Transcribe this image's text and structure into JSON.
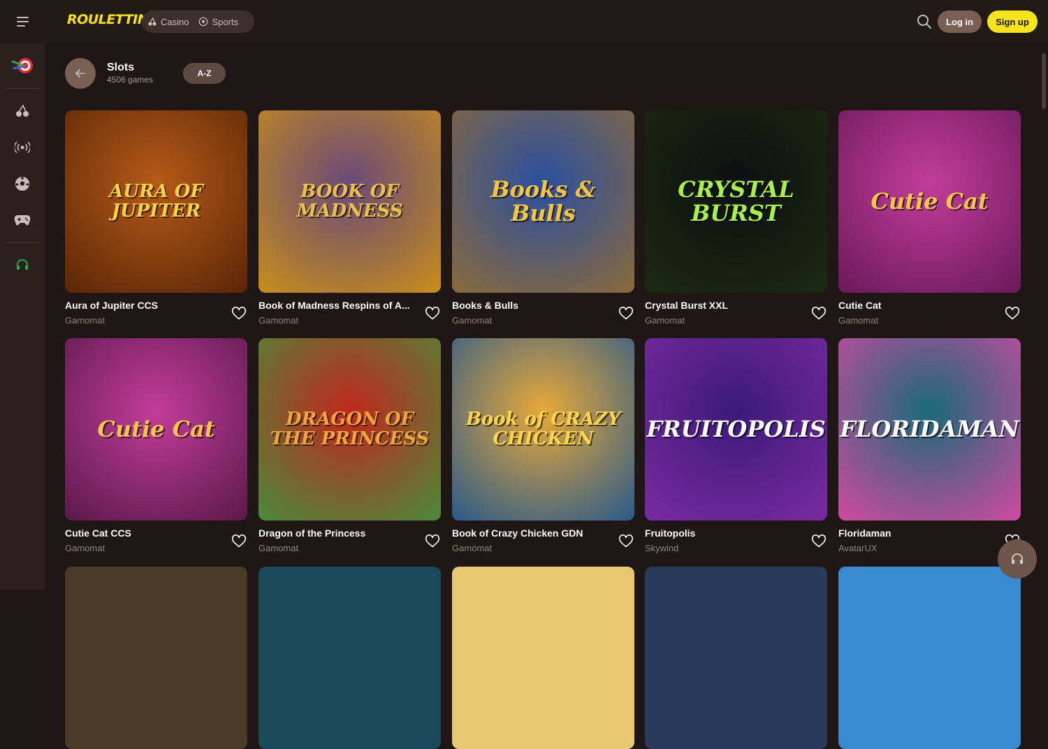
{
  "header": {
    "logo": "ROULETTINO",
    "nav": [
      {
        "label": "Casino",
        "icon": "cherry-icon"
      },
      {
        "label": "Sports",
        "icon": "soccer-ball-icon"
      }
    ],
    "login_label": "Log in",
    "signup_label": "Sign up"
  },
  "colors": {
    "accent": "#f5e31c",
    "button": "#7a5f55",
    "background": "#1e1715",
    "sidebar": "#2a211e"
  },
  "sidebar": {
    "items": [
      {
        "icon": "dart-target-icon"
      },
      {
        "icon": "cherry-icon"
      },
      {
        "icon": "live-broadcast-icon"
      },
      {
        "icon": "soccer-ball-icon"
      },
      {
        "icon": "gamepad-icon"
      },
      {
        "icon": "headset-icon"
      }
    ]
  },
  "page": {
    "title": "Slots",
    "count": "4506 games",
    "sort_label": "A-Z"
  },
  "games": [
    {
      "name": "Aura of Jupiter CCS",
      "provider": "Gamomat",
      "art": "AURA OF JUPITER",
      "bg": "#b65a18",
      "bg2": "#5a2608",
      "fg": "#f6d24a"
    },
    {
      "name": "Book of Madness Respins of A...",
      "provider": "Gamomat",
      "art": "BOOK OF MADNESS",
      "bg": "#6a4a7a",
      "bg2": "#c78d1a",
      "fg": "#e8c04a"
    },
    {
      "name": "Books & Bulls",
      "provider": "Gamomat",
      "art": "Books & Bulls",
      "bg": "#2b4fa0",
      "bg2": "#8a6a3a",
      "fg": "#f5c542"
    },
    {
      "name": "Crystal Burst XXL",
      "provider": "Gamomat",
      "art": "CRYSTAL BURST",
      "bg": "#0e0f12",
      "bg2": "#1c2a12",
      "fg": "#a8f04a"
    },
    {
      "name": "Cutie Cat",
      "provider": "Gamomat",
      "art": "Cutie Cat",
      "bg": "#c23d9a",
      "bg2": "#6a1a5a",
      "fg": "#f9c44a"
    },
    {
      "name": "Cutie Cat CCS",
      "provider": "Gamomat",
      "art": "Cutie Cat",
      "bg": "#c23d9a",
      "bg2": "#5a1a4a",
      "fg": "#f9c44a"
    },
    {
      "name": "Dragon of the Princess",
      "provider": "Gamomat",
      "art": "DRAGON OF THE PRINCESS",
      "bg": "#c0281e",
      "bg2": "#4a8a3a",
      "fg": "#f2a43a"
    },
    {
      "name": "Book of Crazy Chicken GDN",
      "provider": "Gamomat",
      "art": "Book of CRAZY CHICKEN",
      "bg": "#e8a83a",
      "bg2": "#2a5a8a",
      "fg": "#ffd54a"
    },
    {
      "name": "Fruitopolis",
      "provider": "Skywind",
      "art": "FRUITOPOLIS",
      "bg": "#3a1a7a",
      "bg2": "#7a2aa0",
      "fg": "#ffffff"
    },
    {
      "name": "Floridaman",
      "provider": "AvatarUX",
      "art": "FLORIDAMAN",
      "bg": "#1a6a7a",
      "bg2": "#d04aa0",
      "fg": "#ffffff"
    }
  ],
  "partial_row": [
    {
      "bg": "#4a3a2a"
    },
    {
      "bg": "#1a4a5a"
    },
    {
      "bg": "#e8c870"
    },
    {
      "bg": "#2a3a5a"
    },
    {
      "bg": "#3a8ad0"
    }
  ]
}
